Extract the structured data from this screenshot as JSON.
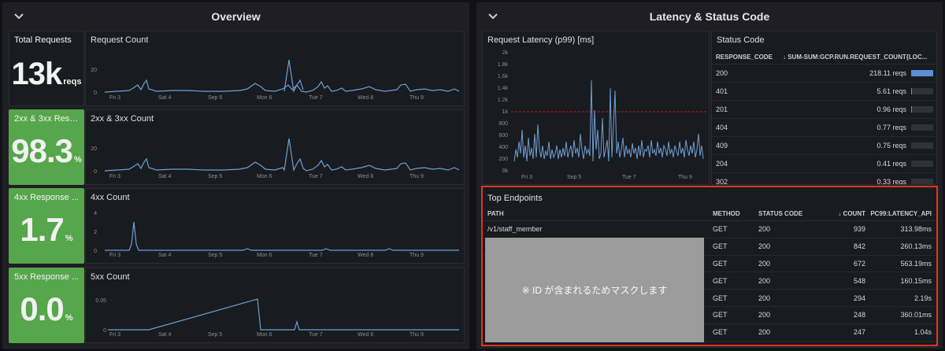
{
  "overview": {
    "title": "Overview",
    "stats": [
      {
        "title": "Total Requests",
        "value": "13k",
        "unit": "reqs"
      },
      {
        "title": "2xx & 3xx Resp...",
        "value": "98.3",
        "unit": "%"
      },
      {
        "title": "4xx Response ...",
        "value": "1.7",
        "unit": "%"
      },
      {
        "title": "5xx Response ...",
        "value": "0.0",
        "unit": "%"
      }
    ],
    "charts": [
      {
        "title": "Request Count",
        "y_ticks": [
          "20",
          "0"
        ]
      },
      {
        "title": "2xx & 3xx Count",
        "y_ticks": [
          "20",
          "0"
        ]
      },
      {
        "title": "4xx Count",
        "y_ticks": [
          "4",
          "2",
          "0"
        ]
      },
      {
        "title": "5xx Count",
        "y_ticks": [
          "0.05",
          "0"
        ]
      }
    ],
    "x_ticks": [
      "Fri 3",
      "Sat 4",
      "Sep 5",
      "Mon 6",
      "Tue 7",
      "Wed 8",
      "Thu 9"
    ]
  },
  "latency": {
    "title": "Latency & Status Code",
    "chart": {
      "title": "Request Latency (p99) [ms]",
      "y_ticks": [
        "2k",
        "1.8k",
        "1.6k",
        "1.4k",
        "1.2k",
        "1k",
        "800",
        "600",
        "400",
        "200",
        "0k"
      ],
      "x_ticks": [
        "Fri 3",
        "Sep 5",
        "Tue 7",
        "Thu 9"
      ]
    },
    "status_code": {
      "title": "Status Code",
      "col_code": "RESPONSE_CODE",
      "col_count": "↓ SUM-SUM:GCP.RUN.REQUEST_COUNT{LOC...",
      "rows": [
        {
          "code": "200",
          "value": "218.11 reqs",
          "fraction": 1.0
        },
        {
          "code": "401",
          "value": "5.61 reqs",
          "fraction": 0.03
        },
        {
          "code": "201",
          "value": "0.96 reqs",
          "fraction": 0.01
        },
        {
          "code": "404",
          "value": "0.77 reqs",
          "fraction": 0.0
        },
        {
          "code": "409",
          "value": "0.75 reqs",
          "fraction": 0.0
        },
        {
          "code": "204",
          "value": "0.41 reqs",
          "fraction": 0.0
        },
        {
          "code": "302",
          "value": "0.33 reqs",
          "fraction": 0.0
        }
      ]
    },
    "top_endpoints": {
      "title": "Top Endpoints",
      "columns": {
        "path": "PATH",
        "method": "METHOD",
        "status": "STATUS CODE",
        "count": "↓ COUNT",
        "latency": "PC99:LATENCY_API"
      },
      "mask_text": "※ ID が含まれるためマスクします",
      "rows": [
        {
          "path": "/v1/staff_member",
          "method": "GET",
          "status": "200",
          "count": "939",
          "latency": "313.98ms"
        },
        {
          "path": "",
          "method": "GET",
          "status": "200",
          "count": "842",
          "latency": "260.13ms"
        },
        {
          "path": "",
          "method": "GET",
          "status": "200",
          "count": "672",
          "latency": "563.19ms"
        },
        {
          "path": "",
          "method": "GET",
          "status": "200",
          "count": "548",
          "latency": "160.15ms"
        },
        {
          "path": "",
          "method": "GET",
          "status": "200",
          "count": "294",
          "latency": "2.19s"
        },
        {
          "path": "",
          "method": "GET",
          "status": "200",
          "count": "248",
          "latency": "360.01ms"
        },
        {
          "path": "",
          "method": "GET",
          "status": "200",
          "count": "247",
          "latency": "1.04s"
        }
      ]
    }
  },
  "colors": {
    "series": "#6e9fd3",
    "green": "#56a64b",
    "highlight": "#e0351e",
    "threshold": "#c4162a"
  },
  "icons": {
    "collapse": "chevron-down-icon"
  }
}
